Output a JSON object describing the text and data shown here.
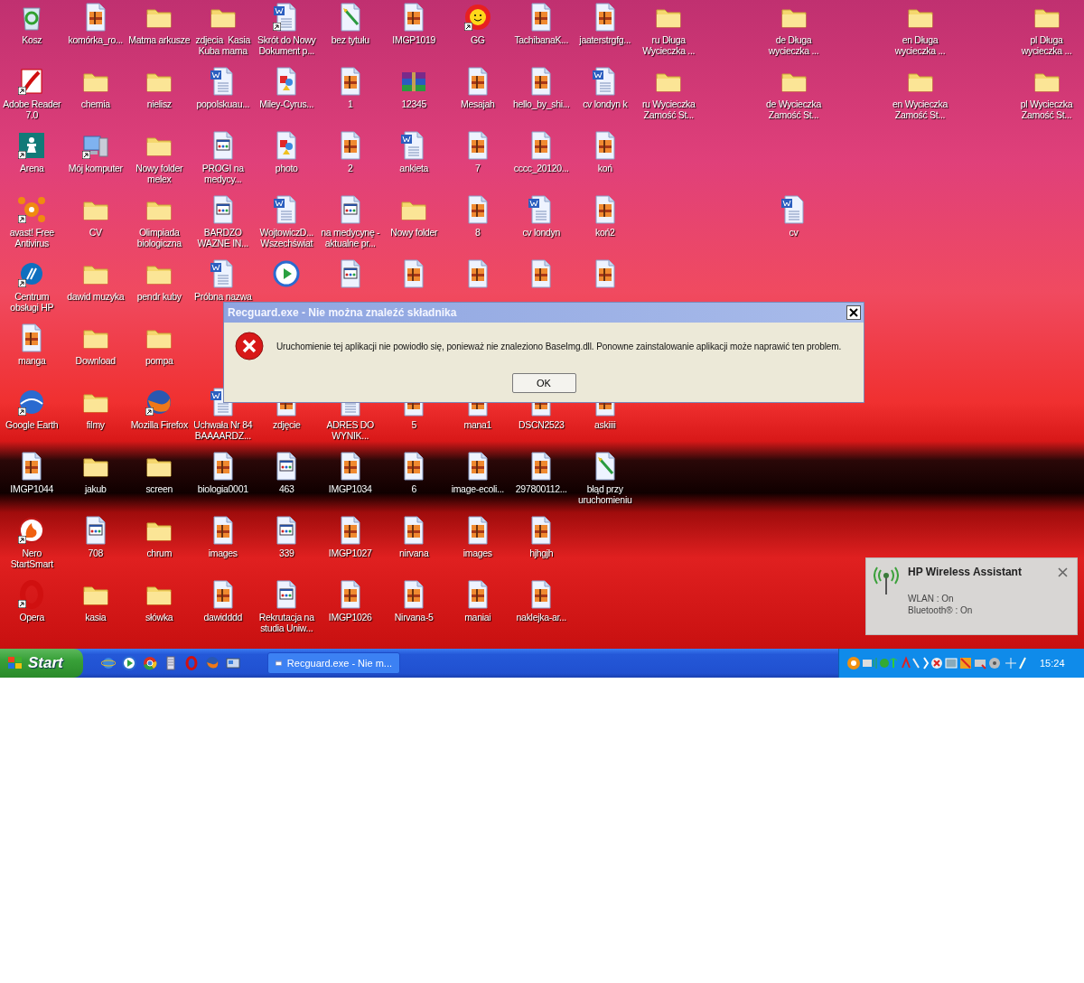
{
  "desktop": {
    "left_columns": [
      {
        "icons": [
          {
            "kind": "recycle",
            "label": "Kosz",
            "shortcut": false
          },
          {
            "kind": "pdf",
            "label": "Adobe Reader 7.0",
            "shortcut": true
          },
          {
            "kind": "chess",
            "label": "Arena",
            "shortcut": true
          },
          {
            "kind": "avast",
            "label": "avast! Free Antivirus",
            "shortcut": true
          },
          {
            "kind": "hp",
            "label": "Centrum obsługi HP",
            "shortcut": true
          },
          {
            "kind": "image",
            "label": "manga",
            "shortcut": false
          },
          {
            "kind": "earth",
            "label": "Google Earth",
            "shortcut": true
          },
          {
            "kind": "image",
            "label": "IMGP1044",
            "shortcut": false
          },
          {
            "kind": "nero",
            "label": "Nero StartSmart",
            "shortcut": true
          },
          {
            "kind": "opera",
            "label": "Opera",
            "shortcut": true
          }
        ]
      },
      {
        "icons": [
          {
            "kind": "image",
            "label": "komórka_ro...",
            "shortcut": false
          },
          {
            "kind": "folder",
            "label": "chemia",
            "shortcut": false
          },
          {
            "kind": "computer",
            "label": "Mój komputer",
            "shortcut": true
          },
          {
            "kind": "folder",
            "label": "CV",
            "shortcut": false
          },
          {
            "kind": "folder",
            "label": "dawid muzyka",
            "shortcut": false
          },
          {
            "kind": "folder",
            "label": "Download",
            "shortcut": false
          },
          {
            "kind": "folder",
            "label": "filmy",
            "shortcut": false
          },
          {
            "kind": "folder",
            "label": "jakub",
            "shortcut": false
          },
          {
            "kind": "html",
            "label": "708",
            "shortcut": false
          },
          {
            "kind": "folder",
            "label": "kasia",
            "shortcut": false
          }
        ]
      },
      {
        "icons": [
          {
            "kind": "folder",
            "label": "Matma arkusze",
            "shortcut": false
          },
          {
            "kind": "folder",
            "label": "nielisz",
            "shortcut": false
          },
          {
            "kind": "folder",
            "label": "Nowy folder melex",
            "shortcut": false
          },
          {
            "kind": "folder",
            "label": "Olimpiada biologiczna",
            "shortcut": false
          },
          {
            "kind": "folder",
            "label": "pendr kuby",
            "shortcut": false
          },
          {
            "kind": "folder",
            "label": "pompa",
            "shortcut": false
          },
          {
            "kind": "firefox",
            "label": "Mozilla Firefox",
            "shortcut": true
          },
          {
            "kind": "folder",
            "label": "screen",
            "shortcut": false
          },
          {
            "kind": "folder",
            "label": "chrum",
            "shortcut": false
          },
          {
            "kind": "folder",
            "label": "słówka",
            "shortcut": false
          }
        ]
      },
      {
        "icons": [
          {
            "kind": "folder",
            "label": "zdjecia  Kasia Kuba mama",
            "shortcut": false
          },
          {
            "kind": "word",
            "label": "popolskuau...",
            "shortcut": false
          },
          {
            "kind": "html",
            "label": "PROGI na medycy...",
            "shortcut": false
          },
          {
            "kind": "html",
            "label": "BARDZO WAZNE IN...",
            "shortcut": false
          },
          {
            "kind": "word",
            "label": "Próbna nazwa",
            "shortcut": false
          },
          {
            "kind": "gap"
          },
          {
            "kind": "word",
            "label": "Uchwała Nr 84 BAAAARDZ...",
            "shortcut": false
          },
          {
            "kind": "image",
            "label": "biologia0001",
            "shortcut": false
          },
          {
            "kind": "image",
            "label": "images",
            "shortcut": false
          },
          {
            "kind": "image",
            "label": "dawidddd",
            "shortcut": false
          }
        ]
      },
      {
        "icons": [
          {
            "kind": "word",
            "label": "Skrót do Nowy Dokument p...",
            "shortcut": true
          },
          {
            "kind": "photo",
            "label": "Miley-Cyrus...",
            "shortcut": false
          },
          {
            "kind": "photo",
            "label": "photo",
            "shortcut": false
          },
          {
            "kind": "word",
            "label": "WojtowiczD... Wszechświat",
            "shortcut": false
          },
          {
            "kind": "media",
            "shortcut": false
          },
          {
            "kind": "gap"
          },
          {
            "kind": "image",
            "label": "zdjęcie",
            "shortcut": false
          },
          {
            "kind": "html",
            "label": "463",
            "shortcut": false
          },
          {
            "kind": "html",
            "label": "339",
            "shortcut": false
          },
          {
            "kind": "html",
            "label": "Rekrutacja na studia Uniw...",
            "shortcut": false
          }
        ]
      },
      {
        "icons": [
          {
            "kind": "paint",
            "label": "bez tytułu",
            "shortcut": false
          },
          {
            "kind": "image",
            "label": "1",
            "shortcut": false
          },
          {
            "kind": "image",
            "label": "2",
            "shortcut": false
          },
          {
            "kind": "html",
            "label": "na medycynę - aktualne pr...",
            "shortcut": false
          },
          {
            "kind": "html",
            "shortcut": false
          },
          {
            "kind": "gap"
          },
          {
            "kind": "word",
            "label": "ADRES DO WYNIK...",
            "shortcut": false
          },
          {
            "kind": "image",
            "label": "IMGP1034",
            "shortcut": false
          },
          {
            "kind": "image",
            "label": "IMGP1027",
            "shortcut": false
          },
          {
            "kind": "image",
            "label": "IMGP1026",
            "shortcut": false
          }
        ]
      },
      {
        "icons": [
          {
            "kind": "image",
            "label": "IMGP1019",
            "shortcut": false
          },
          {
            "kind": "archive",
            "label": "12345",
            "shortcut": false
          },
          {
            "kind": "word",
            "label": "ankieta",
            "shortcut": false
          },
          {
            "kind": "folder",
            "label": "Nowy folder",
            "shortcut": false
          },
          {
            "kind": "image",
            "shortcut": false
          },
          {
            "kind": "gap"
          },
          {
            "kind": "image",
            "label": "5",
            "shortcut": false
          },
          {
            "kind": "image",
            "label": "6",
            "shortcut": false
          },
          {
            "kind": "image",
            "label": "nirvana",
            "shortcut": false
          },
          {
            "kind": "image",
            "label": "Nirvana-5",
            "shortcut": false
          }
        ]
      },
      {
        "icons": [
          {
            "kind": "sun",
            "label": "GG",
            "shortcut": true
          },
          {
            "kind": "image",
            "label": "Mesajah",
            "shortcut": false
          },
          {
            "kind": "image",
            "label": "7",
            "shortcut": false
          },
          {
            "kind": "image",
            "label": "8",
            "shortcut": false
          },
          {
            "kind": "image",
            "shortcut": false
          },
          {
            "kind": "gap"
          },
          {
            "kind": "image",
            "label": "mana1",
            "shortcut": false
          },
          {
            "kind": "image",
            "label": "image-ecoli...",
            "shortcut": false
          },
          {
            "kind": "image",
            "label": "images",
            "shortcut": false
          },
          {
            "kind": "image",
            "label": "maniai",
            "shortcut": false
          }
        ]
      },
      {
        "icons": [
          {
            "kind": "image",
            "label": "TachibanaK...",
            "shortcut": false
          },
          {
            "kind": "image",
            "label": "hello_by_shi...",
            "shortcut": false
          },
          {
            "kind": "image",
            "label": "cccc_20120...",
            "shortcut": false
          },
          {
            "kind": "word",
            "label": "cv londyn",
            "shortcut": false
          },
          {
            "kind": "image",
            "shortcut": false
          },
          {
            "kind": "gap"
          },
          {
            "kind": "image",
            "label": "DSCN2523",
            "shortcut": false
          },
          {
            "kind": "image",
            "label": "297800112...",
            "shortcut": false
          },
          {
            "kind": "image",
            "label": "hjhgjh",
            "shortcut": false
          },
          {
            "kind": "image",
            "label": "naklejka-ar...",
            "shortcut": false
          }
        ]
      },
      {
        "icons": [
          {
            "kind": "image",
            "label": "jaaterstrgfg...",
            "shortcut": false
          },
          {
            "kind": "word",
            "label": "cv londyn k",
            "shortcut": false
          },
          {
            "kind": "image",
            "label": "koń",
            "shortcut": false
          },
          {
            "kind": "image",
            "label": "koń2",
            "shortcut": false
          },
          {
            "kind": "image",
            "shortcut": false
          },
          {
            "kind": "gap"
          },
          {
            "kind": "image",
            "label": "askiiii",
            "shortcut": false
          },
          {
            "kind": "paint",
            "label": "błąd przy uruchomieniu",
            "shortcut": false
          }
        ]
      },
      {
        "icons": [
          {
            "kind": "folder",
            "label": "ru Długa Wycieczka ...",
            "shortcut": false
          },
          {
            "kind": "folder",
            "label": "ru Wycieczka Zamość St...",
            "shortcut": false
          }
        ]
      }
    ],
    "right_columns": [
      {
        "icons": [
          {
            "kind": "folder",
            "label": "de Długa wycieczka ...",
            "shortcut": false
          },
          {
            "kind": "folder",
            "label": "de Wycieczka Zamość St...",
            "shortcut": false
          },
          {
            "kind": "gap"
          },
          {
            "kind": "word",
            "label": "cv",
            "shortcut": false
          }
        ]
      },
      {
        "icons": [
          {
            "kind": "folder",
            "label": "en Długa wycieczka ...",
            "shortcut": false
          },
          {
            "kind": "folder",
            "label": "en Wycieczka Zamość St...",
            "shortcut": false
          }
        ]
      },
      {
        "icons": [
          {
            "kind": "folder",
            "label": "pl Długa wycieczka ...",
            "shortcut": false
          },
          {
            "kind": "folder",
            "label": "pl Wycieczka Zamość St...",
            "shortcut": false
          }
        ]
      }
    ]
  },
  "dialog": {
    "title": "Recguard.exe - Nie można znaleźć składnika",
    "message": "Uruchomienie tej aplikacji nie powiodło się, ponieważ nie znaleziono BaseImg.dll. Ponowne zainstalowanie aplikacji może naprawić ten problem.",
    "button": "OK"
  },
  "notification": {
    "title": "HP Wireless Assistant",
    "lines": [
      "WLAN : On",
      "Bluetooth® : On"
    ]
  },
  "taskbar": {
    "start": "Start",
    "tasks": [
      {
        "label": "Recguard.exe - Nie m...",
        "selected": false
      }
    ],
    "clock": "15:24"
  }
}
